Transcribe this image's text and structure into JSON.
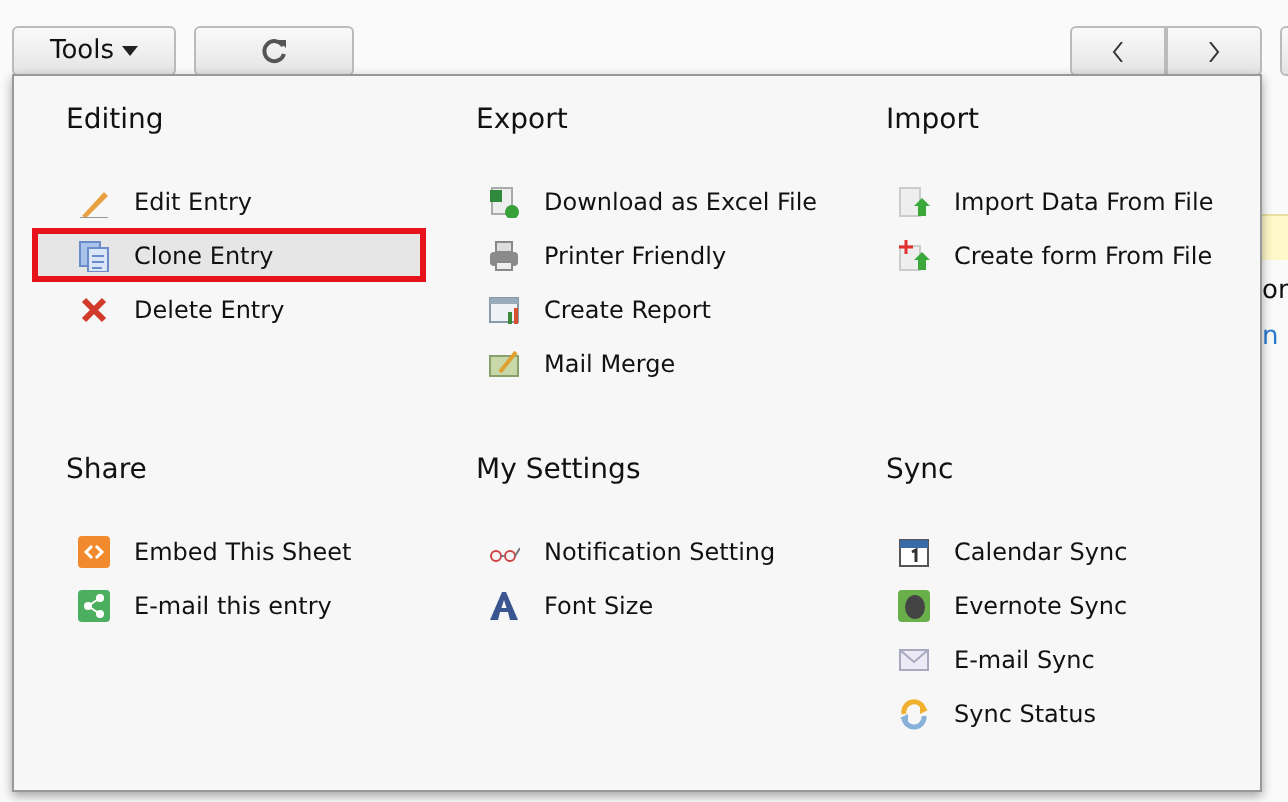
{
  "toolbar": {
    "tools_button": "Tools"
  },
  "menu": {
    "sections": [
      {
        "title": "Editing",
        "items": [
          {
            "label": "Edit Entry",
            "selected": false
          },
          {
            "label": "Clone Entry",
            "selected": true
          },
          {
            "label": "Delete Entry",
            "selected": false
          }
        ]
      },
      {
        "title": "Export",
        "items": [
          {
            "label": "Download as Excel File",
            "selected": false
          },
          {
            "label": "Printer Friendly",
            "selected": false
          },
          {
            "label": "Create Report",
            "selected": false
          },
          {
            "label": "Mail Merge",
            "selected": false
          }
        ]
      },
      {
        "title": "Import",
        "items": [
          {
            "label": "Import Data From File",
            "selected": false
          },
          {
            "label": "Create form From File",
            "selected": false
          }
        ]
      },
      {
        "title": "Share",
        "items": [
          {
            "label": "Embed This Sheet",
            "selected": false
          },
          {
            "label": "E-mail this entry",
            "selected": false
          }
        ]
      },
      {
        "title": "My Settings",
        "items": [
          {
            "label": "Notification Setting",
            "selected": false
          },
          {
            "label": "Font Size",
            "selected": false
          }
        ]
      },
      {
        "title": "Sync",
        "items": [
          {
            "label": "Calendar Sync",
            "selected": false
          },
          {
            "label": "Evernote Sync",
            "selected": false
          },
          {
            "label": "E-mail Sync",
            "selected": false
          },
          {
            "label": "Sync Status",
            "selected": false
          }
        ]
      }
    ]
  },
  "background": {
    "texts": [
      "or",
      "n"
    ]
  }
}
